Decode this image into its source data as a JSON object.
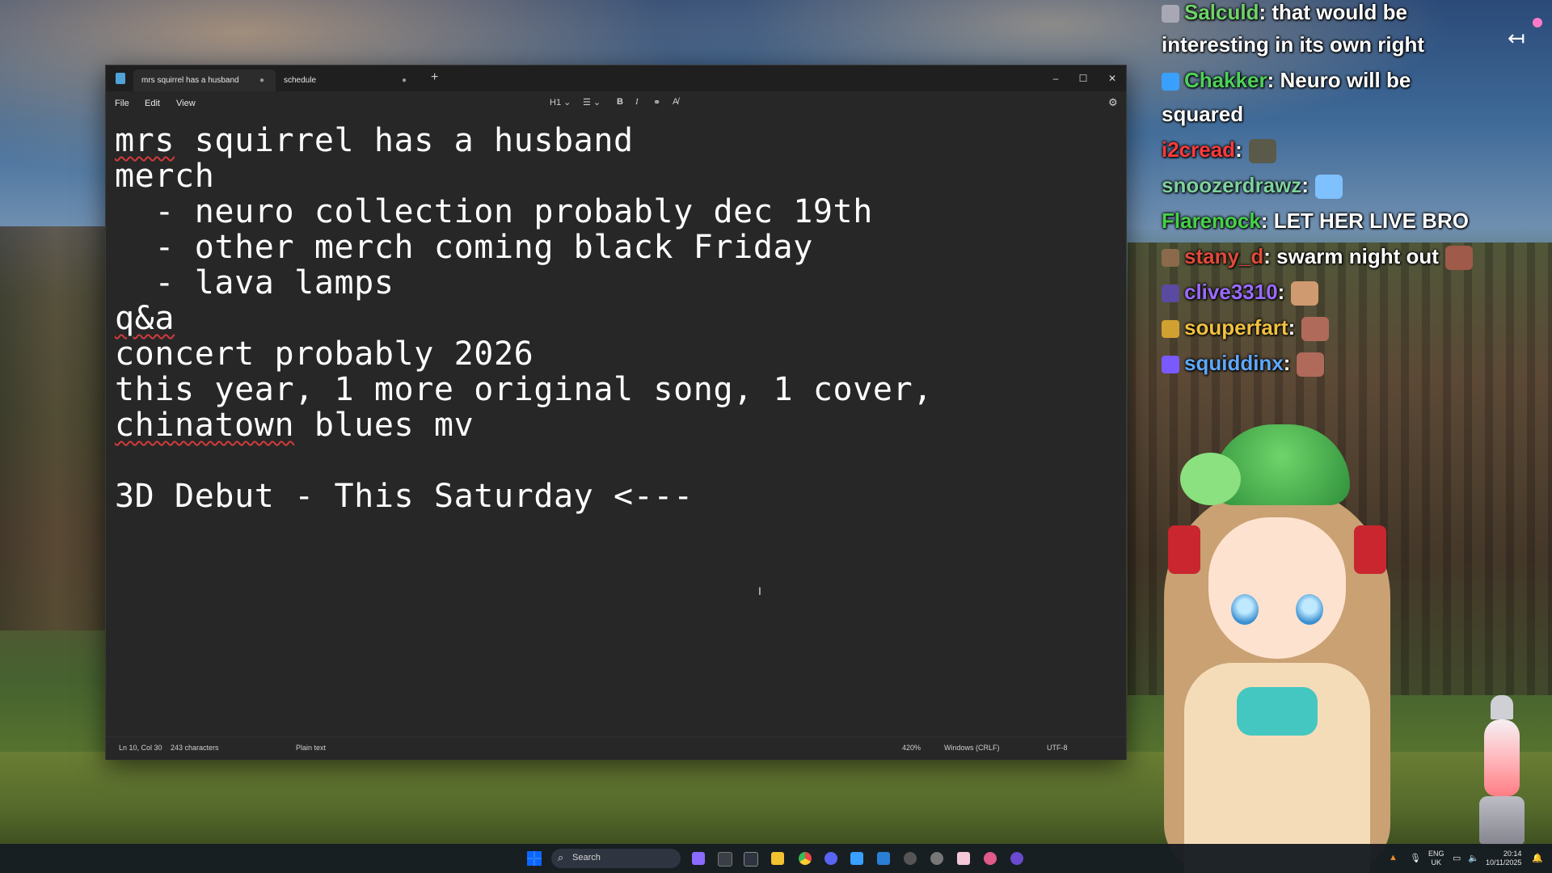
{
  "window": {
    "tabs": [
      {
        "label": "mrs squirrel has a husband",
        "dot": "●"
      },
      {
        "label": "schedule",
        "dot": "●"
      }
    ],
    "new_tab": "+",
    "controls": {
      "minimize": "–",
      "maximize": "☐",
      "close": "✕"
    }
  },
  "menu": {
    "file": "File",
    "edit": "Edit",
    "view": "View"
  },
  "toolbar": {
    "heading": "H1 ⌄",
    "list": "☰ ⌄",
    "bold": "B",
    "italic": "I",
    "link": "⚭",
    "clear_format": "A̸",
    "settings": "⚙"
  },
  "document": {
    "lines": [
      {
        "pre": "",
        "sq": "mrs",
        "post": " squirrel has a husband"
      },
      {
        "pre": "merch",
        "sq": "",
        "post": ""
      },
      {
        "pre": "  - neuro collection probably dec 19th",
        "sq": "",
        "post": ""
      },
      {
        "pre": "  - other merch coming black Friday",
        "sq": "",
        "post": ""
      },
      {
        "pre": "  - lava lamps",
        "sq": "",
        "post": ""
      },
      {
        "pre": "",
        "sq": "q&a",
        "post": ""
      },
      {
        "pre": "concert probably 2026",
        "sq": "",
        "post": ""
      },
      {
        "pre": "this year, 1 more original song, 1 cover,",
        "sq": "",
        "post": ""
      },
      {
        "pre": "",
        "sq": "chinatown",
        "post": " blues mv"
      },
      {
        "pre": "",
        "sq": "",
        "post": ""
      },
      {
        "pre": "3D Debut - This Saturday <---",
        "sq": "",
        "post": ""
      }
    ],
    "cursor": "I"
  },
  "status": {
    "position": "Ln 10, Col 30",
    "chars": "243 characters",
    "format": "Plain text",
    "zoom": "420%",
    "eol": "Windows (CRLF)",
    "encoding": "UTF-8"
  },
  "chat": [
    {
      "user": "Salculd",
      "color": "#6fd36a",
      "badge": "#a8a8b5",
      "text": ": that would be"
    },
    {
      "user": "",
      "color": "#ffffff",
      "badge": "",
      "text": "interesting in its own right"
    },
    {
      "user": "Chakker",
      "color": "#4fd05a",
      "badge": "#3aa0ff",
      "text": ": Neuro will be"
    },
    {
      "user": "",
      "color": "#ffffff",
      "badge": "",
      "text": "squared"
    },
    {
      "user": "i2cread",
      "color": "#ff3a3a",
      "badge": "",
      "text": ":"
    },
    {
      "user": "snoozerdrawz",
      "color": "#7fd0a0",
      "badge": "",
      "text": ":"
    },
    {
      "user": "Flarenock",
      "color": "#48d048",
      "badge": "",
      "text": ": LET HER LIVE BRO"
    },
    {
      "user": "stany_d",
      "color": "#e04a3a",
      "badge": "#8a6a4a",
      "text": ": swarm night out"
    },
    {
      "user": "clive3310",
      "color": "#9a6bff",
      "badge": "#5a4aa0",
      "text": ":"
    },
    {
      "user": "souperfart",
      "color": "#f0c040",
      "badge": "#d0a030",
      "text": ":"
    },
    {
      "user": "squiddinx",
      "color": "#5fa8ff",
      "badge": "#7a5aff",
      "text": ":"
    }
  ],
  "overlay": {
    "back_arrow": "↤"
  },
  "taskbar": {
    "search_label": "Search",
    "search_icon": "⌕",
    "lang": "ENG",
    "region": "UK",
    "time": "20:14",
    "date": "10/11/2025"
  },
  "colors": {
    "editor_bg": "#272727",
    "accent": "#3aa0ff",
    "spell_error": "#d23b3b"
  }
}
